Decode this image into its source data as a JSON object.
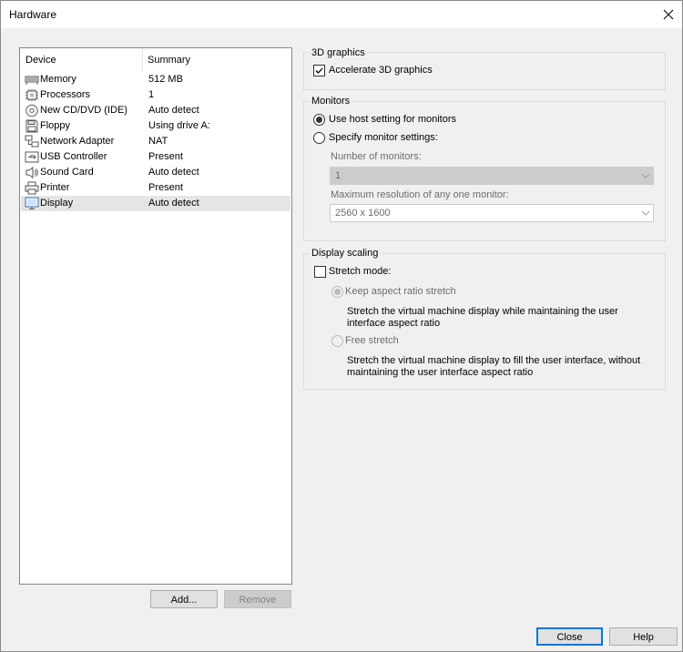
{
  "window": {
    "title": "Hardware"
  },
  "device_list": {
    "columns": {
      "device": "Device",
      "summary": "Summary"
    },
    "rows": [
      {
        "name": "Memory",
        "summary": "512 MB",
        "icon": "memory-icon"
      },
      {
        "name": "Processors",
        "summary": "1",
        "icon": "processor-icon"
      },
      {
        "name": "New CD/DVD (IDE)",
        "summary": "Auto detect",
        "icon": "cd-dvd-icon"
      },
      {
        "name": "Floppy",
        "summary": "Using drive A:",
        "icon": "floppy-icon"
      },
      {
        "name": "Network Adapter",
        "summary": "NAT",
        "icon": "network-adapter-icon"
      },
      {
        "name": "USB Controller",
        "summary": "Present",
        "icon": "usb-icon"
      },
      {
        "name": "Sound Card",
        "summary": "Auto detect",
        "icon": "speaker-icon"
      },
      {
        "name": "Printer",
        "summary": "Present",
        "icon": "printer-icon"
      },
      {
        "name": "Display",
        "summary": "Auto detect",
        "icon": "display-icon",
        "selected": true
      }
    ],
    "add_button": "Add...",
    "remove_button": "Remove"
  },
  "graphics_3d": {
    "group_label": "3D graphics",
    "accelerate_label": "Accelerate 3D graphics",
    "accelerate_checked": true
  },
  "monitors": {
    "group_label": "Monitors",
    "use_host_label": "Use host setting for monitors",
    "specify_label": "Specify monitor settings:",
    "selected": "use_host",
    "number_label": "Number of monitors:",
    "number_value": "1",
    "max_res_label": "Maximum resolution of any one monitor:",
    "max_res_value": "2560 x 1600"
  },
  "display_scaling": {
    "group_label": "Display scaling",
    "stretch_label": "Stretch mode:",
    "stretch_checked": false,
    "keep_aspect_label": "Keep aspect ratio stretch",
    "keep_aspect_desc_line1": "Stretch the virtual machine display while maintaining the user",
    "keep_aspect_desc_line2": "interface aspect ratio",
    "free_label": "Free stretch",
    "free_desc_line1": "Stretch the virtual machine display to fill the user interface, without",
    "free_desc_line2": "maintaining the user interface aspect ratio"
  },
  "footer": {
    "close_button": "Close",
    "help_button": "Help"
  }
}
